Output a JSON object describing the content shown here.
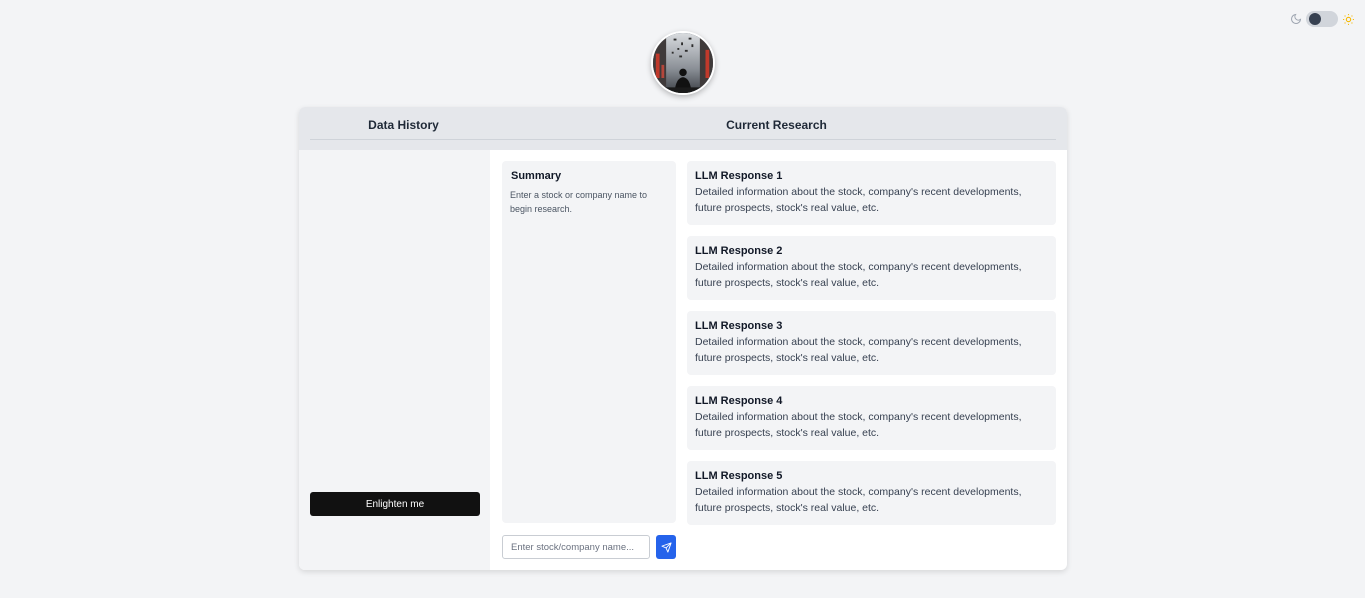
{
  "theme": {
    "moon_icon": "moon-icon",
    "sun_icon": "sun-icon",
    "toggle_state": "light"
  },
  "avatar": {
    "icon": "avatar-image"
  },
  "header": {
    "history_title": "Data History",
    "research_title": "Current Research"
  },
  "sidebar": {
    "enlighten_label": "Enlighten me"
  },
  "summary": {
    "title": "Summary",
    "text": "Enter a stock or company name to begin research."
  },
  "responses": [
    {
      "title": "LLM Response 1",
      "text": "Detailed information about the stock, company's recent developments, future prospects, stock's real value, etc."
    },
    {
      "title": "LLM Response 2",
      "text": "Detailed information about the stock, company's recent developments, future prospects, stock's real value, etc."
    },
    {
      "title": "LLM Response 3",
      "text": "Detailed information about the stock, company's recent developments, future prospects, stock's real value, etc."
    },
    {
      "title": "LLM Response 4",
      "text": "Detailed information about the stock, company's recent developments, future prospects, stock's real value, etc."
    },
    {
      "title": "LLM Response 5",
      "text": "Detailed information about the stock, company's recent developments, future prospects, stock's real value, etc."
    }
  ],
  "search": {
    "placeholder": "Enter stock/company name...",
    "value": "",
    "send_icon": "send-icon"
  },
  "colors": {
    "background": "#f3f4f6",
    "accent": "#2563eb",
    "button_dark": "#111111",
    "sun": "#f5b800"
  }
}
